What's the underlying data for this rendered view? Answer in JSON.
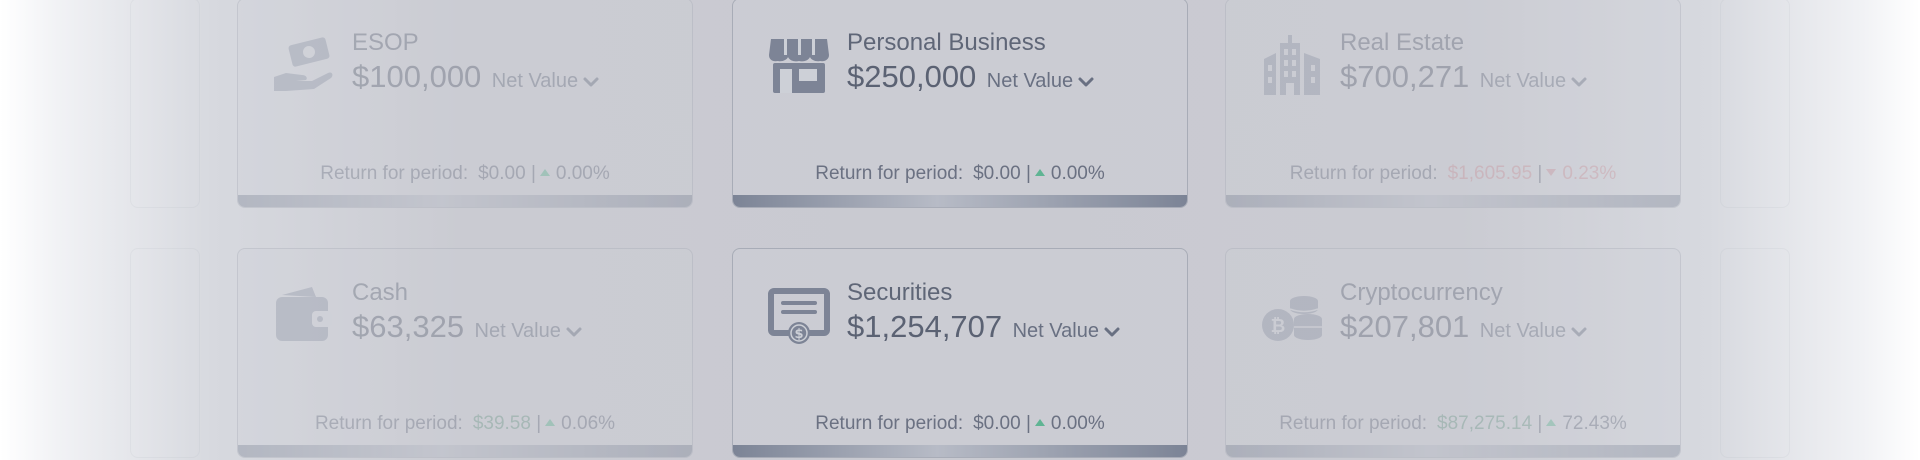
{
  "cards": [
    {
      "title": "ESOP",
      "value": "$100,000",
      "net_label": "Net Value",
      "return_label": "Return for period:",
      "return_amount": "$0.00",
      "separator": "|",
      "return_pct": "0.00%",
      "icon": "money-hand-icon",
      "trend": "up"
    },
    {
      "title": "Personal Business",
      "value": "$250,000",
      "net_label": "Net Value",
      "return_label": "Return for period:",
      "return_amount": "$0.00",
      "separator": "|",
      "return_pct": "0.00%",
      "icon": "storefront-icon",
      "trend": "up"
    },
    {
      "title": "Real Estate",
      "value": "$700,271",
      "net_label": "Net Value",
      "return_label": "Return for period:",
      "return_amount": "$1,605.95",
      "separator": "|",
      "return_pct": "0.23%",
      "icon": "building-icon",
      "trend": "down"
    },
    {
      "title": "Cash",
      "value": "$63,325",
      "net_label": "Net Value",
      "return_label": "Return for period:",
      "return_amount": "$39.58",
      "separator": "|",
      "return_pct": "0.06%",
      "icon": "wallet-icon",
      "trend": "up"
    },
    {
      "title": "Securities",
      "value": "$1,254,707",
      "net_label": "Net Value",
      "return_label": "Return for period:",
      "return_amount": "$0.00",
      "separator": "|",
      "return_pct": "0.00%",
      "icon": "certificate-icon",
      "trend": "up"
    },
    {
      "title": "Cryptocurrency",
      "value": "$207,801",
      "net_label": "Net Value",
      "return_label": "Return for period:",
      "return_amount": "$87,275.14",
      "separator": "|",
      "return_pct": "72.43%",
      "icon": "crypto-coins-icon",
      "trend": "up"
    }
  ],
  "colors": {
    "positive": "#5fb493",
    "negative": "#c9939b",
    "text": "#5b6273"
  }
}
